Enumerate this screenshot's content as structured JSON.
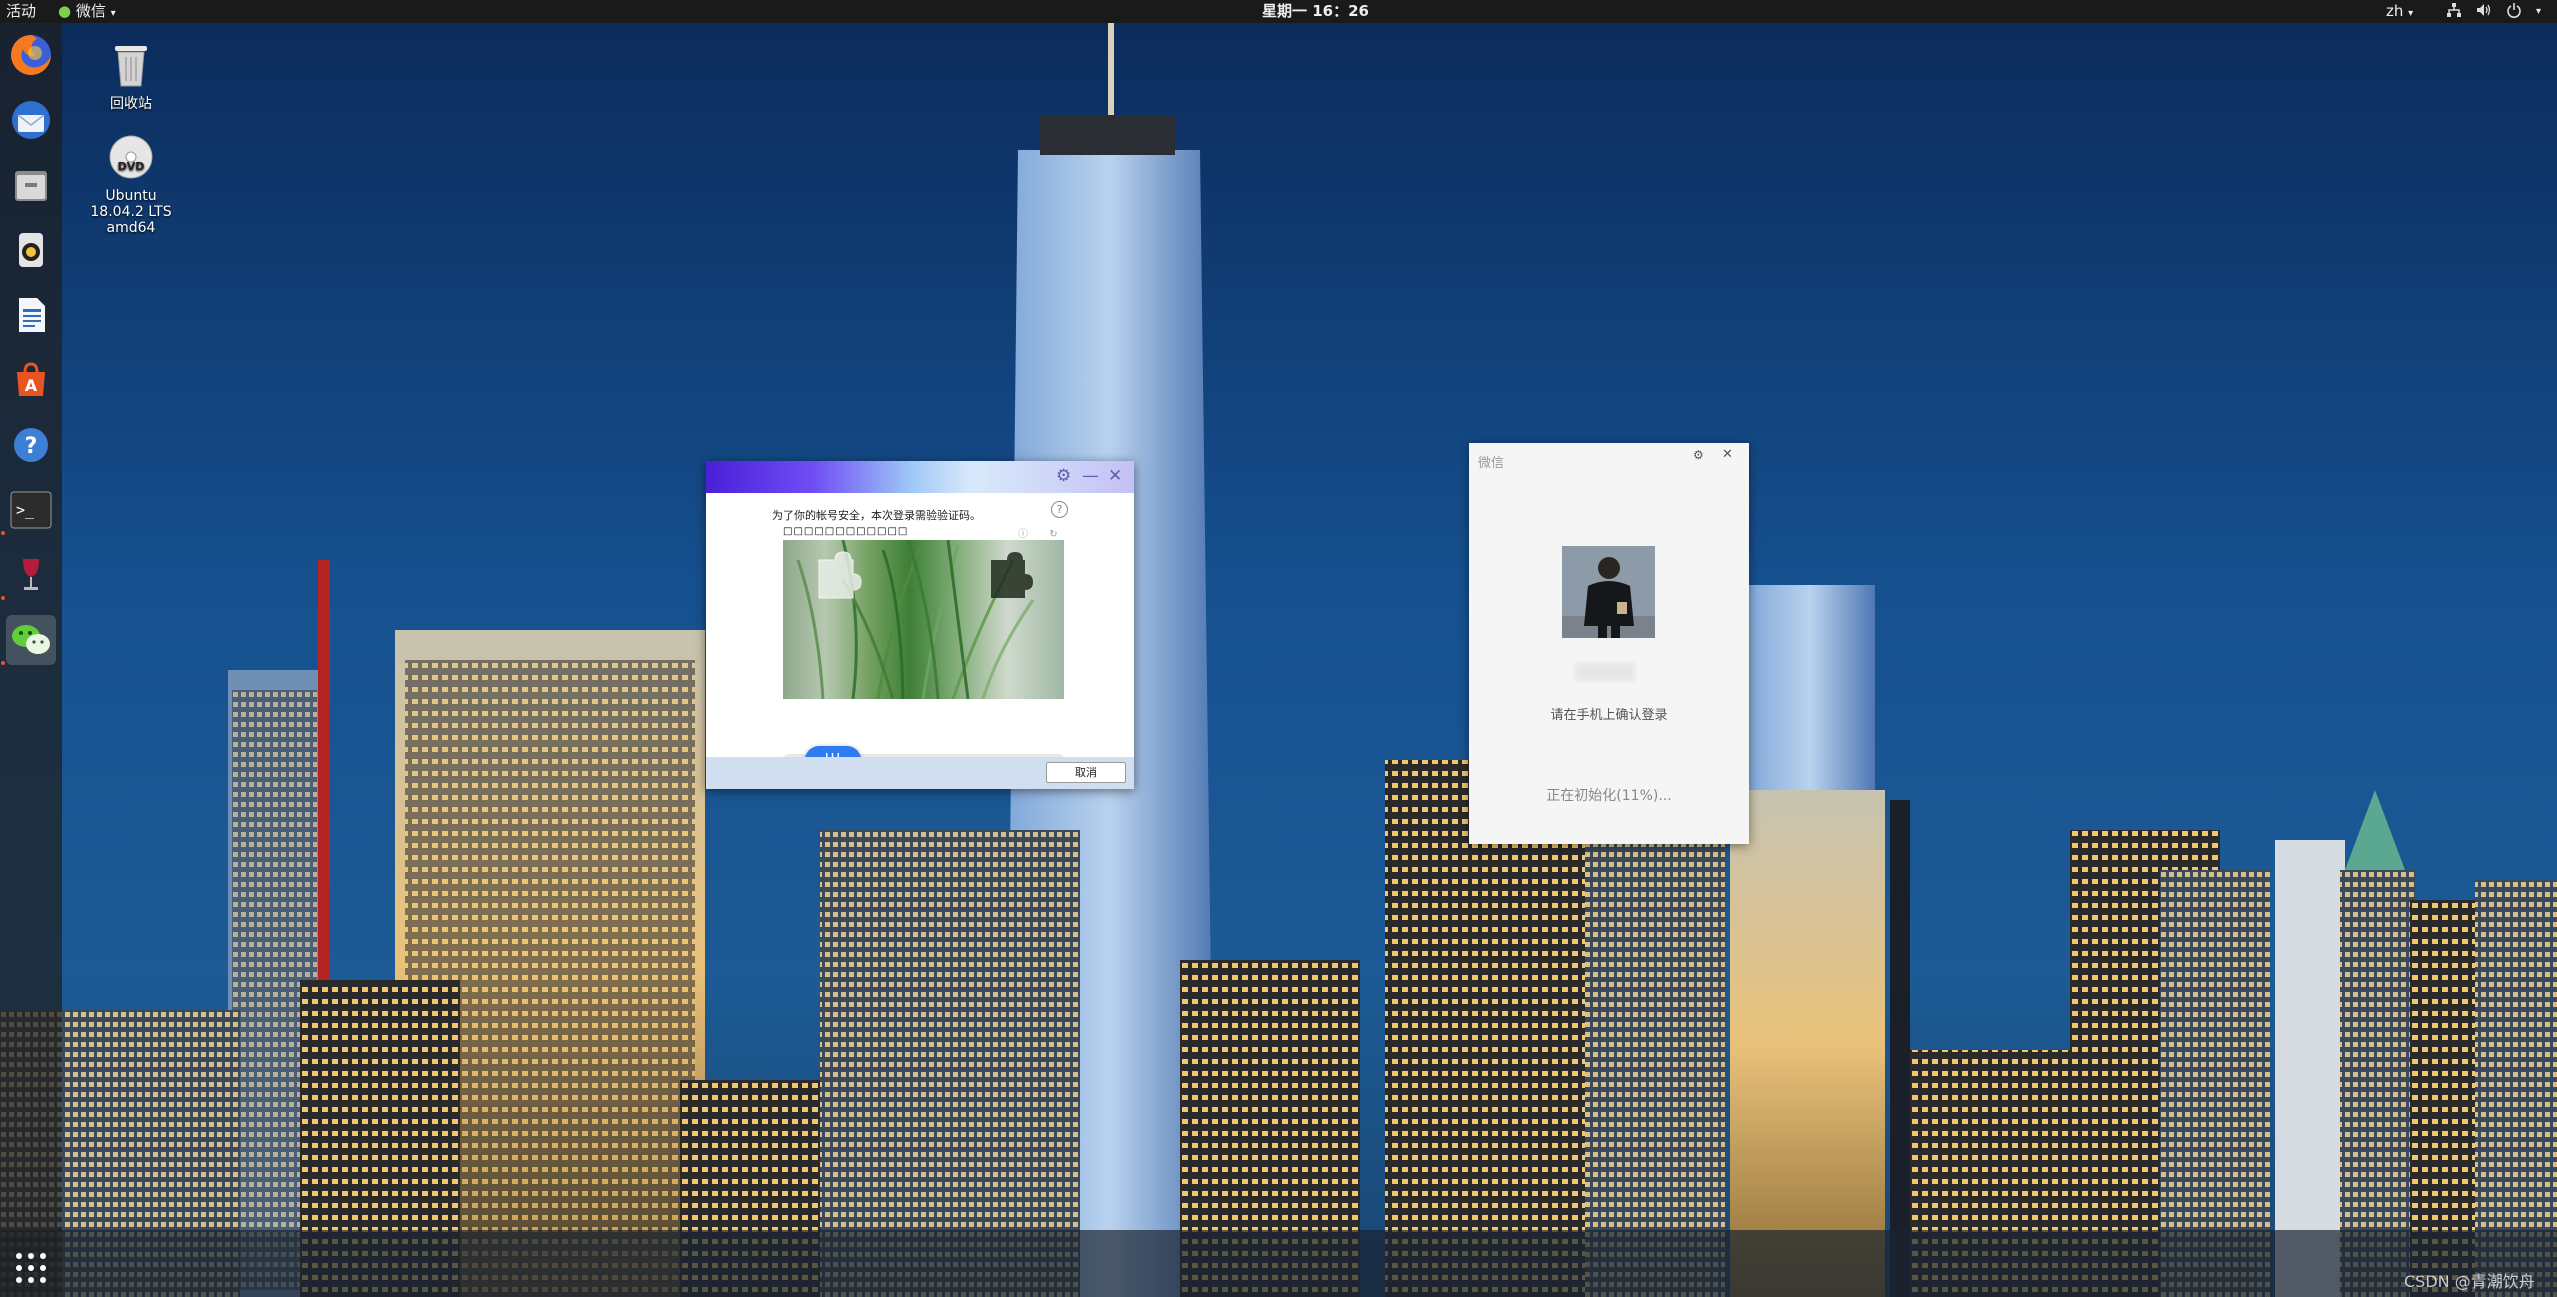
{
  "topbar": {
    "activities": "活动",
    "app_menu": "微信",
    "clock": "星期一 16：26",
    "language": "zh"
  },
  "desktop": {
    "trash_label": "回收站",
    "dvd_label_line1": "Ubuntu",
    "dvd_label_line2": "18.04.2 LTS",
    "dvd_label_line3": "amd64"
  },
  "dock": {
    "items": [
      "firefox-icon",
      "thunderbird-icon",
      "files-icon",
      "rhythmbox-icon",
      "libreoffice-writer-icon",
      "software-center-icon",
      "help-icon",
      "terminal-icon",
      "wine-icon",
      "wechat-icon"
    ],
    "apps_grid": "show-applications-icon"
  },
  "captcha": {
    "prompt": "为了你的帐号安全，本次登录需验验证码。",
    "help": "?",
    "puzzle_hint": "□□□□□□□□□□□□",
    "slider_handle": "|||",
    "cancel_label": "取消"
  },
  "wechat_window": {
    "title": "微信",
    "confirm_text": "请在手机上确认登录",
    "init_status": "正在初始化(11%)..."
  },
  "watermark": "CSDN @青潮饮舟",
  "colors": {
    "accent_blue": "#2f7cf0",
    "ubuntu_orange": "#e95420",
    "topbar_bg": "#1a1a1a"
  }
}
